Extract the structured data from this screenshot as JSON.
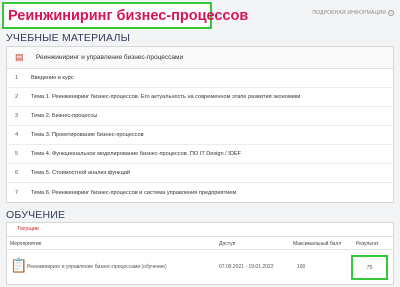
{
  "header": {
    "title": "Реинжиниринг бизнес-процессов",
    "more_info": "ПОДРОБНАЯ ИНФОРМАЦИЯ"
  },
  "materials": {
    "heading": "УЧЕБНЫЕ МАТЕРИАЛЫ",
    "course_title": "Реинжиниринг и управление бизнес-процессами",
    "items": [
      {
        "num": "1",
        "text": "Введение в курс"
      },
      {
        "num": "2",
        "text": "Тема 1. Реинжиниринг бизнес-процессов. Его актуальность на современном этапе развития экономики"
      },
      {
        "num": "3",
        "text": "Тема 2. Бизнес-процессы"
      },
      {
        "num": "4",
        "text": "Тема 3. Проектирование бизнес-процессов"
      },
      {
        "num": "5",
        "text": "Тема 4. Функциональное моделирование бизнес-процессов. ПО IT Design / IDEF"
      },
      {
        "num": "6",
        "text": "Тема 5. Стоимостной анализ функций"
      },
      {
        "num": "7",
        "text": "Тема 6. Реинжиниринг бизнес-процессов и система управления предприятием"
      }
    ]
  },
  "training": {
    "heading": "ОБУЧЕНИЕ",
    "tab_current": "Текущие",
    "columns": {
      "event": "Мероприятие",
      "access": "Доступ",
      "max_score": "Максимальный балл",
      "result": "Результат"
    },
    "row": {
      "event": "Реинжиниринг и управление бизнес-процессами (обучение)",
      "access": "07.09.2021 - 19.01.2022",
      "max_score": "100",
      "result": "75"
    }
  },
  "colors": {
    "title": "#d4145a",
    "highlight_border": "#35c93a",
    "heading": "#2f3a55"
  }
}
